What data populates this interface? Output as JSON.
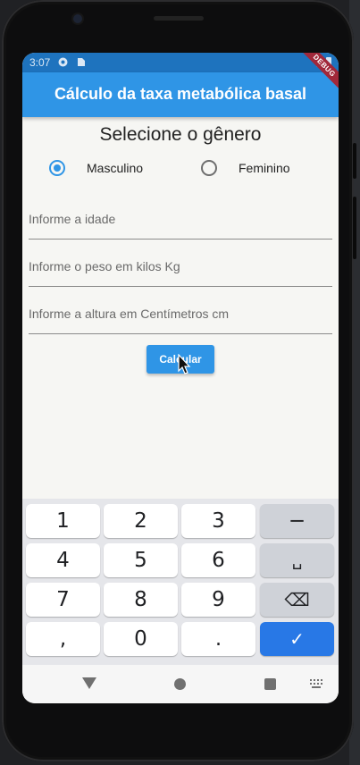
{
  "status_bar": {
    "time": "3:07"
  },
  "app_bar": {
    "title": "Cálculo da taxa metabólica basal",
    "debug_banner": "DEBUG"
  },
  "form": {
    "heading": "Selecione o gênero",
    "gender_options": [
      {
        "label": "Masculino",
        "selected": true
      },
      {
        "label": "Feminino",
        "selected": false
      }
    ],
    "age_placeholder": "Informe a idade",
    "weight_placeholder": "Informe o peso em kilos Kg",
    "height_placeholder": "Informe a altura em Centímetros cm",
    "submit_label": "Calcular"
  },
  "keyboard": {
    "rows": [
      [
        "1",
        "2",
        "3",
        "−"
      ],
      [
        "4",
        "5",
        "6",
        "␣"
      ],
      [
        "7",
        "8",
        "9",
        "⌫"
      ],
      [
        ",",
        "0",
        ".",
        "✓"
      ]
    ]
  },
  "colors": {
    "primary": "#2f95e6",
    "status_bar": "#1e73be",
    "debug": "#a1283a",
    "done_key": "#2878e6"
  }
}
